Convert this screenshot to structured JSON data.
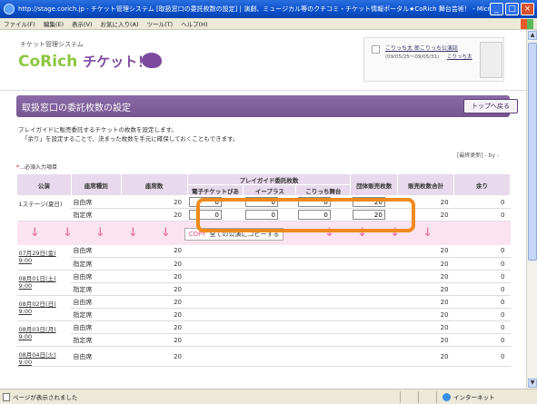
{
  "window": {
    "title": "http://stage.corich.jp - チケット管理システム [取扱窓口の委託枚数の設定] | 演劇、ミュージカル等のクチコミ・チケット情報ポータル★CoRich 舞台芸術！ - Micros...",
    "menu": [
      "ファイル(F)",
      "編集(E)",
      "表示(V)",
      "お気に入り(A)",
      "ツール(T)",
      "ヘルプ(H)"
    ],
    "status_text": "ページが表示されました",
    "zone": "インターネット"
  },
  "site": {
    "subtitle": "チケット管理システム",
    "brand_latin": "CoRich",
    "brand_jp": "チケット！",
    "user_link": "こりっち太",
    "user_link2": "郎こりっち公演誌",
    "user_dates": "(09/05/25〜09/05/31)",
    "user_link3": "こりっち太"
  },
  "section": {
    "title": "取扱窓口の委託枚数の設定",
    "top_button": "トップへ戻る",
    "desc1": "プレイガイドに販売委託するチケットの枚数を設定します。",
    "desc2": "「余り」を設定することで、決まった枚数を手元に確保しておくこともできます。",
    "last_update": "[最終更新] - by -",
    "required_mark": "*",
    "required_note": "…必須入力項目"
  },
  "table": {
    "headers": {
      "performance": "公演",
      "seat_type": "座席種別",
      "seat_count": "座席数",
      "playguide": "プレイガイド委託枚数",
      "pg_cols": [
        "電子チケットぴあ",
        "イープラス",
        "こりっち舞台"
      ],
      "group": "団体販売枚数",
      "total": "販売枚数合計",
      "remaining": "余り"
    },
    "first": {
      "performance": "1ステージ(夏日)",
      "rows": [
        {
          "seat": "自由席",
          "count": "20",
          "pia": "0",
          "eplus": "0",
          "corich": "0",
          "group": "20",
          "total": "20",
          "rem": "0"
        },
        {
          "seat": "指定席",
          "count": "20",
          "pia": "0",
          "eplus": "0",
          "corich": "0",
          "group": "20",
          "total": "20",
          "rem": "0"
        }
      ]
    },
    "copy": {
      "label": "COPY",
      "text": "全ての公演にコピーする"
    },
    "rest": [
      {
        "date": "07月29日(金)",
        "time": "9:00",
        "rows": [
          {
            "seat": "自由席",
            "count": "20"
          },
          {
            "seat": "指定席",
            "count": "20"
          }
        ]
      },
      {
        "date": "08月01日(土)",
        "time": "9:00",
        "rows": [
          {
            "seat": "自由席",
            "count": "20"
          },
          {
            "seat": "指定席",
            "count": "20"
          }
        ]
      },
      {
        "date": "08月02日(日)",
        "time": "9:00",
        "rows": [
          {
            "seat": "自由席",
            "count": "20"
          },
          {
            "seat": "指定席",
            "count": "20"
          }
        ]
      },
      {
        "date": "08月03日(月)",
        "time": "9:00",
        "rows": [
          {
            "seat": "自由席",
            "count": "20"
          },
          {
            "seat": "指定席",
            "count": "20"
          }
        ]
      },
      {
        "date": "08月04日(火)",
        "time": "9:00",
        "rows": [
          {
            "seat": "自由席",
            "count": "20"
          }
        ]
      }
    ],
    "rest_values": {
      "total": "20",
      "rem": "0"
    }
  },
  "colors": {
    "accent": "#7d4a9e",
    "brand_green": "#8dc63f",
    "highlight": "#f08a1c",
    "header_bg": "#e8d9ec"
  }
}
